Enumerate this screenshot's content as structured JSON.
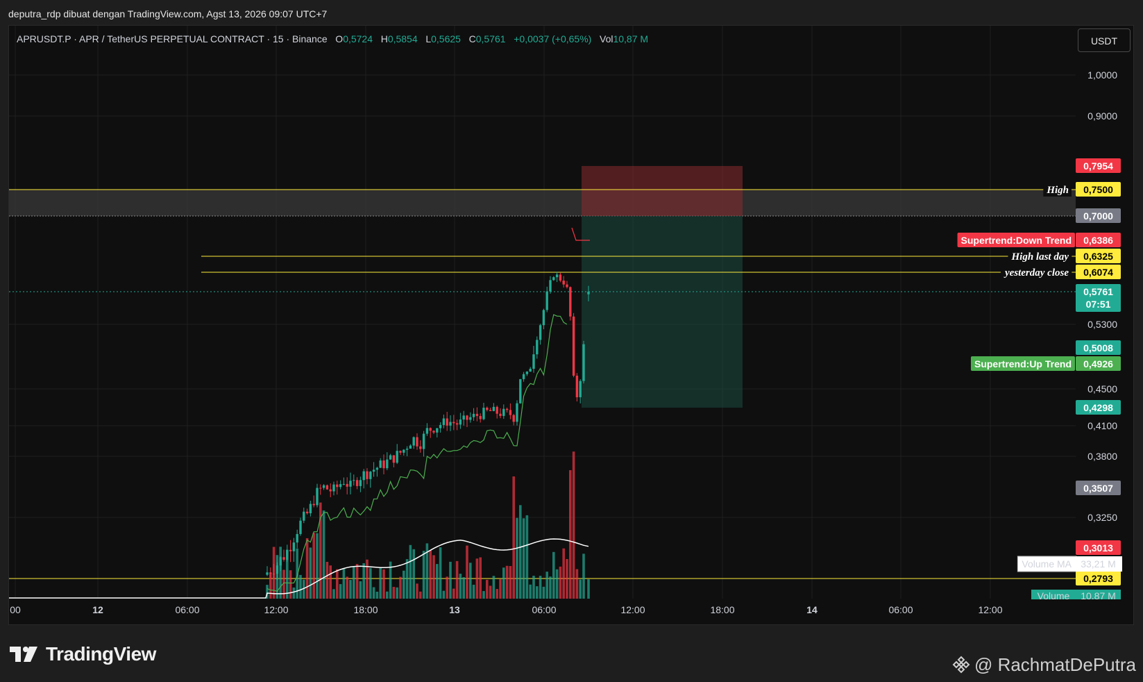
{
  "header": {
    "attribution": "deputra_rdp dibuat dengan TradingView.com, Agst 13, 2026 09:07 UTC+7"
  },
  "legend": {
    "symbol": "APRUSDT.P · APR / TetherUS PERPETUAL CONTRACT · 15 · Binance",
    "o_label": "O",
    "o_value": "0,5724",
    "h_label": "H",
    "h_value": "0,5854",
    "l_label": "L",
    "l_value": "0,5625",
    "c_label": "C",
    "c_value": "0,5761",
    "change": "+0,0037 (+0,65%)",
    "vol_label": "Vol",
    "vol_value": "10,87 M"
  },
  "currency_button": "USDT",
  "footer": {
    "brand": "TradingView",
    "credit": "@ RachmatDePutra"
  },
  "colors": {
    "up": "#22ab94",
    "down": "#f23645",
    "supertrend_up": "#4caf50",
    "supertrend_down": "#f23645",
    "level_line": "#ffeb3b",
    "volume_ma": "#ffffff",
    "background": "#0f0f0f"
  },
  "chart_data": {
    "type": "candlestick",
    "symbol": "APRUSDT.P",
    "interval": "15",
    "exchange": "Binance",
    "ylim": [
      0.2793,
      1.0
    ],
    "y_ticks": [
      "1,0000",
      "0,9000",
      "0,5300",
      "0,4500",
      "0,4100",
      "0,3800",
      "0,3250"
    ],
    "y_tick_values": [
      1.0,
      0.9,
      0.53,
      0.45,
      0.41,
      0.38,
      0.325
    ],
    "x_ticks": [
      {
        "label": "00",
        "bold": false
      },
      {
        "label": "12",
        "bold": true
      },
      {
        "label": "06:00",
        "bold": false
      },
      {
        "label": "12:00",
        "bold": false
      },
      {
        "label": "18:00",
        "bold": false
      },
      {
        "label": "13",
        "bold": true
      },
      {
        "label": "06:00",
        "bold": false
      },
      {
        "label": "12:00",
        "bold": false
      },
      {
        "label": "18:00",
        "bold": false
      },
      {
        "label": "14",
        "bold": true
      },
      {
        "label": "06:00",
        "bold": false
      },
      {
        "label": "12:00",
        "bold": false
      }
    ],
    "price_tags": [
      {
        "label": "0,7954",
        "value": 0.7954,
        "kind": "down"
      },
      {
        "label": "0,7500",
        "value": 0.75,
        "kind": "level"
      },
      {
        "label": "0,7000",
        "value": 0.7,
        "kind": "gray"
      },
      {
        "label": "0,6386",
        "value": 0.6386,
        "kind": "down"
      },
      {
        "label": "0,6325",
        "value": 0.6325,
        "kind": "level"
      },
      {
        "label": "0,6074",
        "value": 0.6074,
        "kind": "level"
      },
      {
        "label": "0,5761",
        "value": 0.5761,
        "kind": "up",
        "countdown": "07:51"
      },
      {
        "label": "0,5008",
        "value": 0.5008,
        "kind": "up"
      },
      {
        "label": "0,4926",
        "value": 0.4926,
        "kind": "supertrend_up"
      },
      {
        "label": "0,4298",
        "value": 0.4298,
        "kind": "up"
      },
      {
        "label": "0,3507",
        "value": 0.3507,
        "kind": "gray"
      },
      {
        "label": "0,3013",
        "value": 0.3013,
        "kind": "down"
      },
      {
        "label": "0,2793",
        "value": 0.2793,
        "kind": "level"
      }
    ],
    "level_notes": [
      {
        "text": "High",
        "value": 0.75
      },
      {
        "text": "High last day",
        "value": 0.6325
      },
      {
        "text": "yesterday close",
        "value": 0.6074
      }
    ],
    "indicator_tags": [
      {
        "text": "Supertrend:Down Trend",
        "value": 0.6386,
        "kind": "down"
      },
      {
        "text": "Supertrend:Up Trend",
        "value": 0.4926,
        "kind": "supertrend_up"
      }
    ],
    "volume": {
      "ma_label": "Volume MA",
      "ma_value": "33,21 M",
      "label": "Volume",
      "value": "10,87 M"
    },
    "position_zone": {
      "entry": 0.7,
      "stop": 0.7954,
      "target": 0.4298
    },
    "current": {
      "open": 0.5724,
      "high": 0.5854,
      "low": 0.5625,
      "close": 0.5761
    }
  }
}
